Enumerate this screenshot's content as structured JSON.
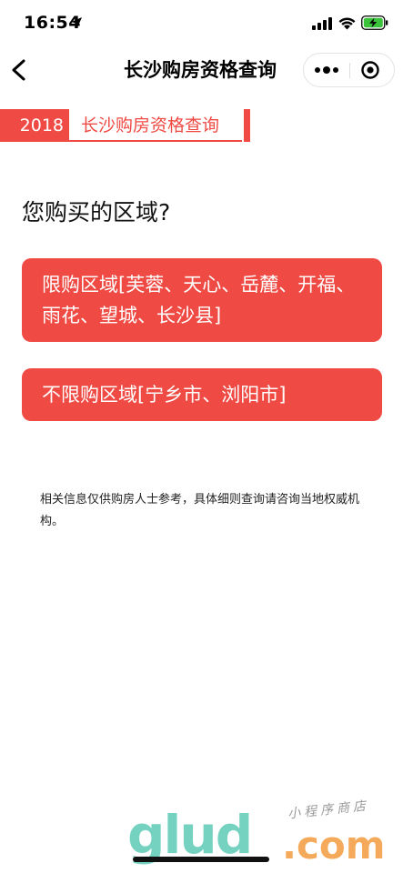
{
  "status_bar": {
    "time": "16:54"
  },
  "nav": {
    "title": "长沙购房资格查询"
  },
  "banner": {
    "year": "2018",
    "title": "长沙购房资格查询"
  },
  "question": "您购买的区域?",
  "options": [
    {
      "label": "限购区域[芙蓉、天心、岳麓、开福、雨花、望城、长沙县]"
    },
    {
      "label": "不限购区域[宁乡市、浏阳市]"
    }
  ],
  "disclaimer": "相关信息仅供购房人士参考，具体细则查询请咨询当地权威机构。",
  "watermark": {
    "logo": "glud",
    "suffix": ".com",
    "tagline": "小程序商店"
  },
  "colors": {
    "accent": "#ef4a43",
    "watermark_green": "#55c7b1",
    "watermark_orange": "#f39c3e"
  },
  "icons": [
    "location-icon",
    "signal-icon",
    "wifi-icon",
    "battery-charging-icon",
    "back-icon",
    "more-icon",
    "close-mini-program-icon"
  ]
}
